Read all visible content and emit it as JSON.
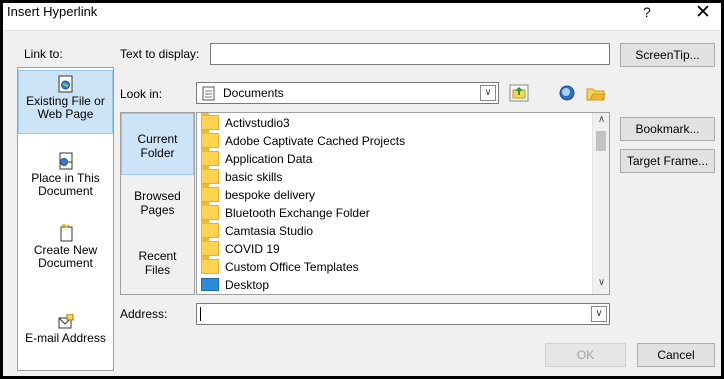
{
  "window": {
    "title": "Insert Hyperlink",
    "help_label": "?",
    "close_label": "✕"
  },
  "link_to": {
    "label": "Link to:",
    "items": [
      {
        "label_line1": "Existing File or",
        "label_line2": "Web Page",
        "icon": "web-page-icon",
        "selected": true
      },
      {
        "label_line1": "Place in This",
        "label_line2": "Document",
        "icon": "document-place-icon",
        "selected": false
      },
      {
        "label_line1": "Create New",
        "label_line2": "Document",
        "icon": "new-document-icon",
        "selected": false
      },
      {
        "label_line1": "E-mail Address",
        "label_line2": "",
        "icon": "email-icon",
        "selected": false
      }
    ]
  },
  "text_to_display": {
    "label": "Text to display:",
    "value": ""
  },
  "screentip_label": "ScreenTip...",
  "look_in": {
    "label": "Look in:",
    "value": "Documents",
    "icon": "documents-folder-icon"
  },
  "toolbar_icons": [
    "browse-web-icon",
    "browse-for-file-icon"
  ],
  "up_folder_icon": "up-one-folder-icon",
  "folder_buttons": [
    {
      "label_line1": "Current",
      "label_line2": "Folder",
      "selected": true
    },
    {
      "label_line1": "Browsed",
      "label_line2": "Pages",
      "selected": false
    },
    {
      "label_line1": "Recent",
      "label_line2": "Files",
      "selected": false
    }
  ],
  "files": [
    {
      "name": "Activstudio3",
      "type": "folder"
    },
    {
      "name": "Adobe Captivate Cached Projects",
      "type": "folder"
    },
    {
      "name": "Application Data",
      "type": "folder"
    },
    {
      "name": "basic skills",
      "type": "folder"
    },
    {
      "name": "bespoke delivery",
      "type": "folder"
    },
    {
      "name": "Bluetooth Exchange Folder",
      "type": "folder"
    },
    {
      "name": "Camtasia Studio",
      "type": "folder"
    },
    {
      "name": "COVID 19",
      "type": "folder"
    },
    {
      "name": "Custom Office Templates",
      "type": "folder"
    },
    {
      "name": "Desktop",
      "type": "desktop"
    }
  ],
  "side_buttons": {
    "bookmark": "Bookmark...",
    "target_frame": "Target Frame..."
  },
  "address": {
    "label": "Address:",
    "value": ""
  },
  "ok_label": "OK",
  "cancel_label": "Cancel"
}
